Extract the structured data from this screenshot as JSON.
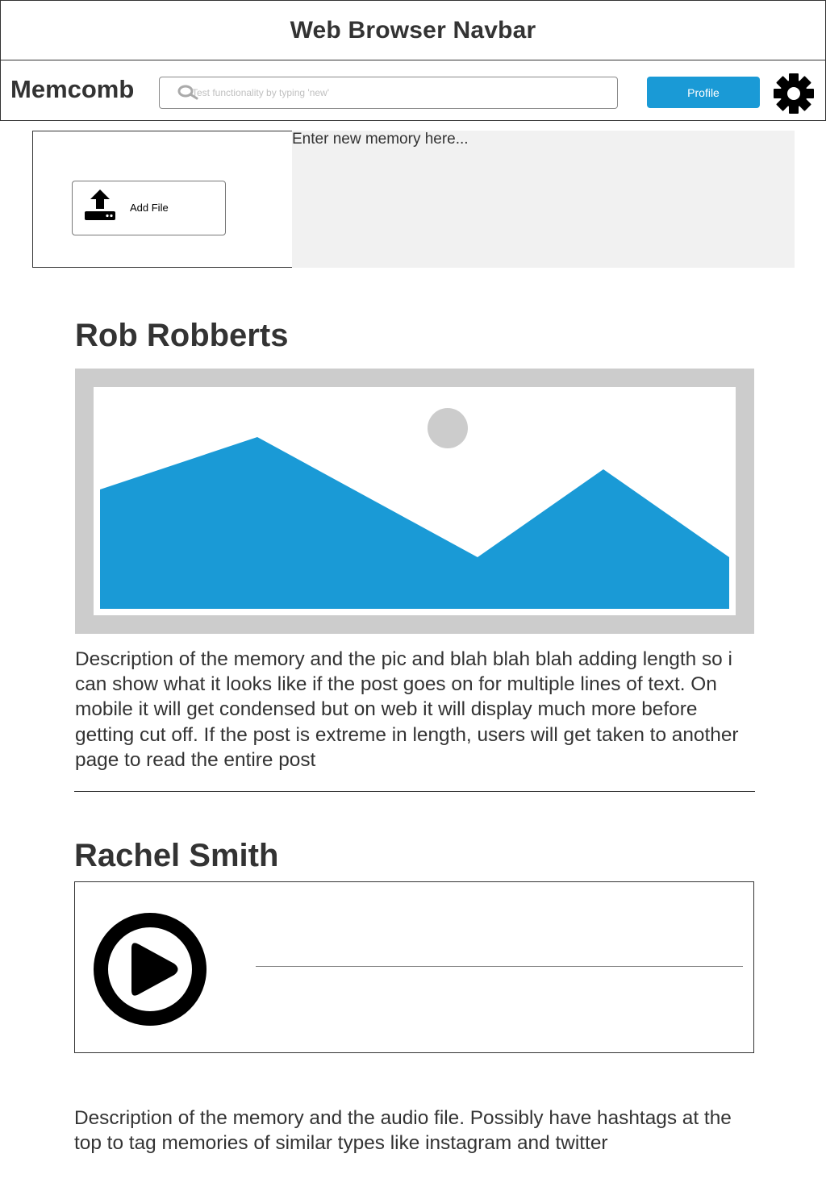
{
  "browser": {
    "title": "Web Browser Navbar"
  },
  "navbar": {
    "brand": "Memcomb",
    "search_placeholder": "Test functionality by typing 'new'",
    "search_icon": "search-icon",
    "profile_label": "Profile",
    "settings_icon": "gear-icon"
  },
  "composer": {
    "add_file_label": "Add File",
    "add_file_icon": "upload-icon",
    "memory_placeholder": "Enter new memory here..."
  },
  "posts": [
    {
      "author": "Rob Robberts",
      "media": "image-placeholder",
      "description": "Description of the memory and the pic and blah blah blah adding length so i can show what it looks like if the post goes on for multiple lines of text. On mobile it will get condensed but on web it will display much more before getting cut off. If the post is extreme in length, users will get taken to another page to read the entire post"
    },
    {
      "author": "Rachel Smith",
      "media": "audio-player",
      "description": "Description of the memory and the audio file. Possibly have hashtags at the top to tag memories of similar types like instagram and twitter"
    }
  ],
  "colors": {
    "accent": "#1a9ad6",
    "text": "#333333",
    "input_background": "#f1f1f1",
    "image_frame": "#cccccc"
  }
}
